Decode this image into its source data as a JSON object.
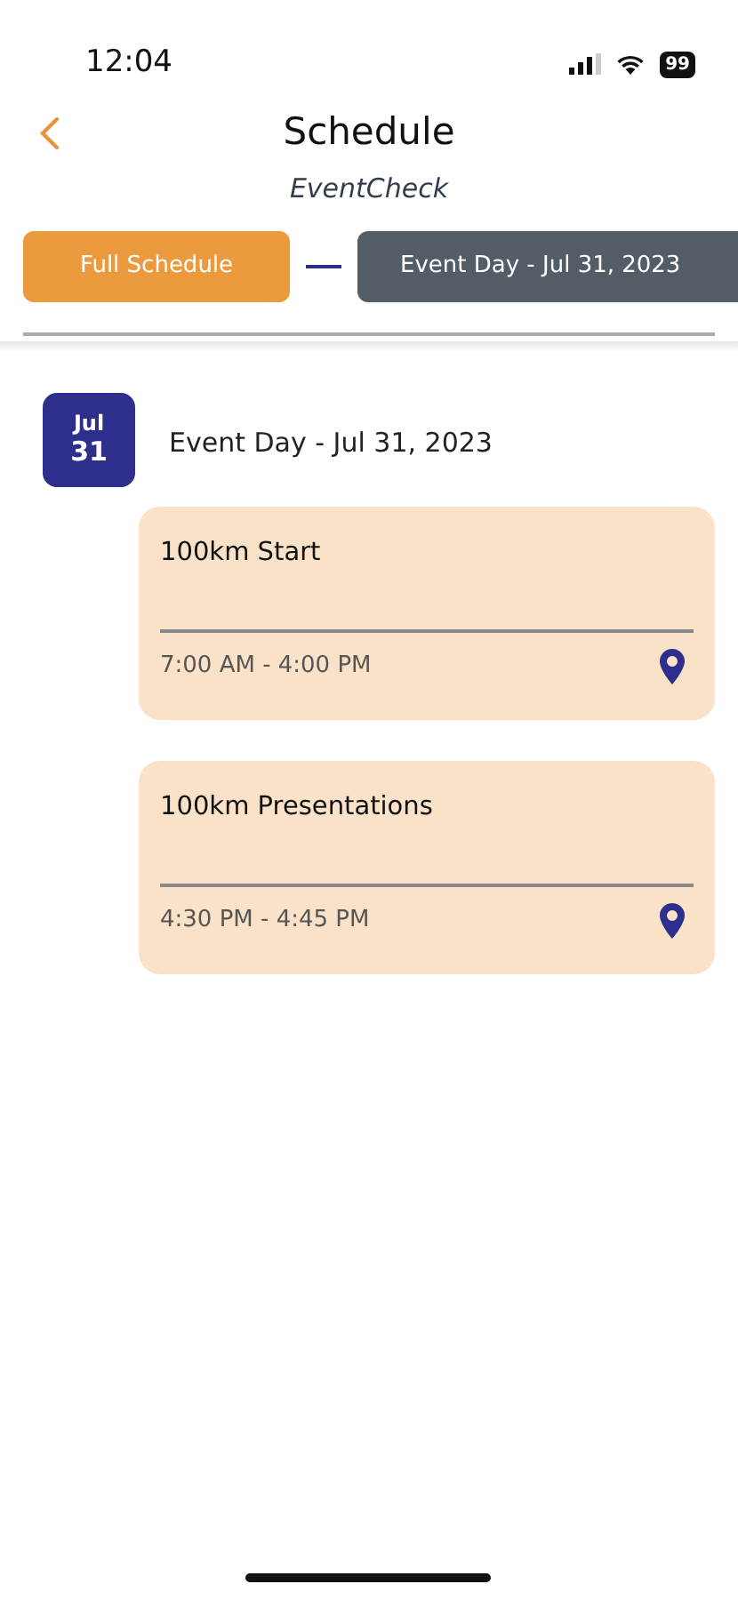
{
  "status_bar": {
    "time": "12:04",
    "battery": "99"
  },
  "header": {
    "title": "Schedule",
    "subtitle": "EventCheck"
  },
  "tabs": [
    {
      "label": "Full Schedule",
      "selected": false
    },
    {
      "label": "Event Day - Jul 31, 2023",
      "selected": true
    }
  ],
  "day": {
    "month": "Jul",
    "date": "31",
    "heading": "Event Day - Jul 31, 2023"
  },
  "events": [
    {
      "title": "100km Start",
      "time": "7:00 AM - 4:00 PM"
    },
    {
      "title": "100km Presentations",
      "time": "4:30 PM - 4:45 PM"
    }
  ]
}
